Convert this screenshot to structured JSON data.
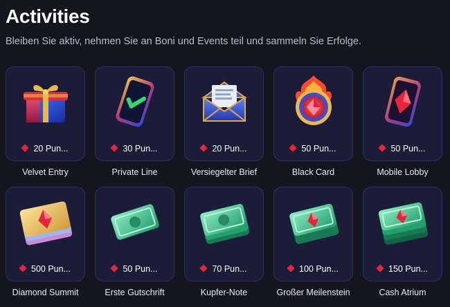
{
  "page": {
    "title": "Activities",
    "subtitle": "Bleiben Sie aktiv, nehmen Sie an Boni und Events teil und sammeln Sie Erfolge."
  },
  "colors": {
    "background": "#14151f",
    "card": "#1a1c38",
    "card_border": "#2e3158",
    "gem": "#e8233a"
  },
  "activities": [
    {
      "name": "Velvet Entry",
      "points": "20 Pun...",
      "icon": "gift-box-icon"
    },
    {
      "name": "Private Line",
      "points": "30 Pun...",
      "icon": "phone-check-icon"
    },
    {
      "name": "Versiegelter Brief",
      "points": "20 Pun...",
      "icon": "envelope-icon"
    },
    {
      "name": "Black Card",
      "points": "50 Pun...",
      "icon": "flame-gem-badge-icon"
    },
    {
      "name": "Mobile Lobby",
      "points": "50 Pun...",
      "icon": "phone-gem-icon"
    },
    {
      "name": "Diamond Summit",
      "points": "500 Pun...",
      "icon": "gold-tickets-icon"
    },
    {
      "name": "Erste Gutschrift",
      "points": "50 Pun...",
      "icon": "banknote-icon"
    },
    {
      "name": "Kupfer-Note",
      "points": "70 Pun...",
      "icon": "banknote-stack-icon"
    },
    {
      "name": "Großer Meilenstein",
      "points": "100 Pun...",
      "icon": "gem-banknotes-icon"
    },
    {
      "name": "Cash Atrium",
      "points": "150 Pun...",
      "icon": "gem-cash-stack-icon"
    }
  ]
}
